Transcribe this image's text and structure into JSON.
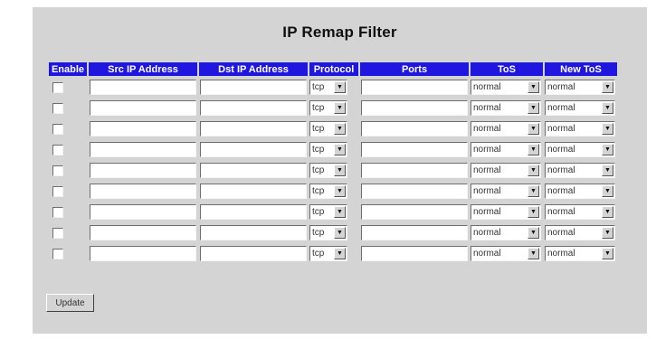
{
  "page": {
    "title": "IP Remap Filter"
  },
  "table": {
    "headers": {
      "enable": "Enable",
      "src_ip": "Src IP Address",
      "dst_ip": "Dst IP Address",
      "protocol": "Protocol",
      "ports": "Ports",
      "tos": "ToS",
      "new_tos": "New ToS"
    },
    "rows": [
      {
        "enabled": false,
        "src_ip": "",
        "dst_ip": "",
        "protocol": "tcp",
        "ports": "",
        "tos": "normal",
        "new_tos": "normal"
      },
      {
        "enabled": false,
        "src_ip": "",
        "dst_ip": "",
        "protocol": "tcp",
        "ports": "",
        "tos": "normal",
        "new_tos": "normal"
      },
      {
        "enabled": false,
        "src_ip": "",
        "dst_ip": "",
        "protocol": "tcp",
        "ports": "",
        "tos": "normal",
        "new_tos": "normal"
      },
      {
        "enabled": false,
        "src_ip": "",
        "dst_ip": "",
        "protocol": "tcp",
        "ports": "",
        "tos": "normal",
        "new_tos": "normal"
      },
      {
        "enabled": false,
        "src_ip": "",
        "dst_ip": "",
        "protocol": "tcp",
        "ports": "",
        "tos": "normal",
        "new_tos": "normal"
      },
      {
        "enabled": false,
        "src_ip": "",
        "dst_ip": "",
        "protocol": "tcp",
        "ports": "",
        "tos": "normal",
        "new_tos": "normal"
      },
      {
        "enabled": false,
        "src_ip": "",
        "dst_ip": "",
        "protocol": "tcp",
        "ports": "",
        "tos": "normal",
        "new_tos": "normal"
      },
      {
        "enabled": false,
        "src_ip": "",
        "dst_ip": "",
        "protocol": "tcp",
        "ports": "",
        "tos": "normal",
        "new_tos": "normal"
      },
      {
        "enabled": false,
        "src_ip": "",
        "dst_ip": "",
        "protocol": "tcp",
        "ports": "",
        "tos": "normal",
        "new_tos": "normal"
      }
    ]
  },
  "buttons": {
    "update": "Update"
  },
  "icons": {
    "dropdown": "chevron-down-icon"
  },
  "colors": {
    "header_bg": "#1f17e0",
    "panel_bg": "#d4d4d4"
  }
}
